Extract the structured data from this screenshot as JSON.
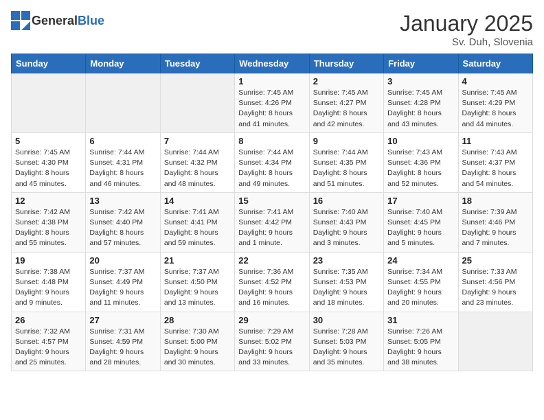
{
  "header": {
    "logo_general": "General",
    "logo_blue": "Blue",
    "month": "January 2025",
    "location": "Sv. Duh, Slovenia"
  },
  "weekdays": [
    "Sunday",
    "Monday",
    "Tuesday",
    "Wednesday",
    "Thursday",
    "Friday",
    "Saturday"
  ],
  "weeks": [
    [
      {
        "day": "",
        "info": ""
      },
      {
        "day": "",
        "info": ""
      },
      {
        "day": "",
        "info": ""
      },
      {
        "day": "1",
        "info": "Sunrise: 7:45 AM\nSunset: 4:26 PM\nDaylight: 8 hours and 41 minutes."
      },
      {
        "day": "2",
        "info": "Sunrise: 7:45 AM\nSunset: 4:27 PM\nDaylight: 8 hours and 42 minutes."
      },
      {
        "day": "3",
        "info": "Sunrise: 7:45 AM\nSunset: 4:28 PM\nDaylight: 8 hours and 43 minutes."
      },
      {
        "day": "4",
        "info": "Sunrise: 7:45 AM\nSunset: 4:29 PM\nDaylight: 8 hours and 44 minutes."
      }
    ],
    [
      {
        "day": "5",
        "info": "Sunrise: 7:45 AM\nSunset: 4:30 PM\nDaylight: 8 hours and 45 minutes."
      },
      {
        "day": "6",
        "info": "Sunrise: 7:44 AM\nSunset: 4:31 PM\nDaylight: 8 hours and 46 minutes."
      },
      {
        "day": "7",
        "info": "Sunrise: 7:44 AM\nSunset: 4:32 PM\nDaylight: 8 hours and 48 minutes."
      },
      {
        "day": "8",
        "info": "Sunrise: 7:44 AM\nSunset: 4:34 PM\nDaylight: 8 hours and 49 minutes."
      },
      {
        "day": "9",
        "info": "Sunrise: 7:44 AM\nSunset: 4:35 PM\nDaylight: 8 hours and 51 minutes."
      },
      {
        "day": "10",
        "info": "Sunrise: 7:43 AM\nSunset: 4:36 PM\nDaylight: 8 hours and 52 minutes."
      },
      {
        "day": "11",
        "info": "Sunrise: 7:43 AM\nSunset: 4:37 PM\nDaylight: 8 hours and 54 minutes."
      }
    ],
    [
      {
        "day": "12",
        "info": "Sunrise: 7:42 AM\nSunset: 4:38 PM\nDaylight: 8 hours and 55 minutes."
      },
      {
        "day": "13",
        "info": "Sunrise: 7:42 AM\nSunset: 4:40 PM\nDaylight: 8 hours and 57 minutes."
      },
      {
        "day": "14",
        "info": "Sunrise: 7:41 AM\nSunset: 4:41 PM\nDaylight: 8 hours and 59 minutes."
      },
      {
        "day": "15",
        "info": "Sunrise: 7:41 AM\nSunset: 4:42 PM\nDaylight: 9 hours and 1 minute."
      },
      {
        "day": "16",
        "info": "Sunrise: 7:40 AM\nSunset: 4:43 PM\nDaylight: 9 hours and 3 minutes."
      },
      {
        "day": "17",
        "info": "Sunrise: 7:40 AM\nSunset: 4:45 PM\nDaylight: 9 hours and 5 minutes."
      },
      {
        "day": "18",
        "info": "Sunrise: 7:39 AM\nSunset: 4:46 PM\nDaylight: 9 hours and 7 minutes."
      }
    ],
    [
      {
        "day": "19",
        "info": "Sunrise: 7:38 AM\nSunset: 4:48 PM\nDaylight: 9 hours and 9 minutes."
      },
      {
        "day": "20",
        "info": "Sunrise: 7:37 AM\nSunset: 4:49 PM\nDaylight: 9 hours and 11 minutes."
      },
      {
        "day": "21",
        "info": "Sunrise: 7:37 AM\nSunset: 4:50 PM\nDaylight: 9 hours and 13 minutes."
      },
      {
        "day": "22",
        "info": "Sunrise: 7:36 AM\nSunset: 4:52 PM\nDaylight: 9 hours and 16 minutes."
      },
      {
        "day": "23",
        "info": "Sunrise: 7:35 AM\nSunset: 4:53 PM\nDaylight: 9 hours and 18 minutes."
      },
      {
        "day": "24",
        "info": "Sunrise: 7:34 AM\nSunset: 4:55 PM\nDaylight: 9 hours and 20 minutes."
      },
      {
        "day": "25",
        "info": "Sunrise: 7:33 AM\nSunset: 4:56 PM\nDaylight: 9 hours and 23 minutes."
      }
    ],
    [
      {
        "day": "26",
        "info": "Sunrise: 7:32 AM\nSunset: 4:57 PM\nDaylight: 9 hours and 25 minutes."
      },
      {
        "day": "27",
        "info": "Sunrise: 7:31 AM\nSunset: 4:59 PM\nDaylight: 9 hours and 28 minutes."
      },
      {
        "day": "28",
        "info": "Sunrise: 7:30 AM\nSunset: 5:00 PM\nDaylight: 9 hours and 30 minutes."
      },
      {
        "day": "29",
        "info": "Sunrise: 7:29 AM\nSunset: 5:02 PM\nDaylight: 9 hours and 33 minutes."
      },
      {
        "day": "30",
        "info": "Sunrise: 7:28 AM\nSunset: 5:03 PM\nDaylight: 9 hours and 35 minutes."
      },
      {
        "day": "31",
        "info": "Sunrise: 7:26 AM\nSunset: 5:05 PM\nDaylight: 9 hours and 38 minutes."
      },
      {
        "day": "",
        "info": ""
      }
    ]
  ]
}
